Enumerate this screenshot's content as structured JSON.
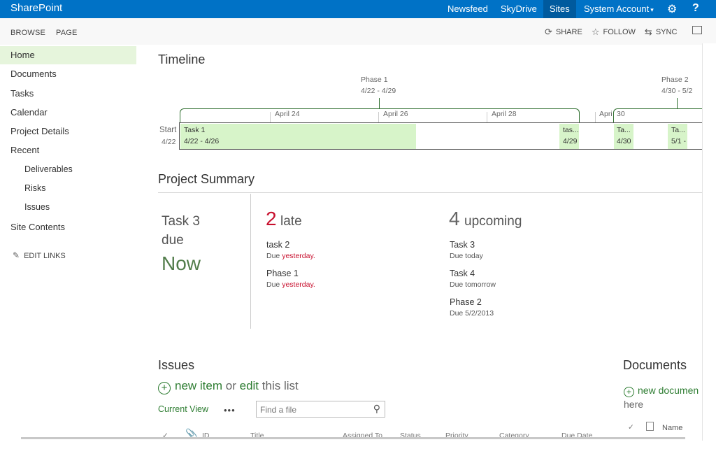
{
  "suite": {
    "brand": "SharePoint",
    "links": [
      "Newsfeed",
      "SkyDrive",
      "Sites"
    ],
    "account": "System Account",
    "caret": "▾",
    "help": "?"
  },
  "ribbon": {
    "tabs": [
      "BROWSE",
      "PAGE"
    ],
    "actions": [
      "SHARE",
      "FOLLOW",
      "SYNC"
    ]
  },
  "nav": {
    "items": [
      "Home",
      "Documents",
      "Tasks",
      "Calendar",
      "Project Details",
      "Recent"
    ],
    "recent": [
      "Deliverables",
      "Risks",
      "Issues"
    ],
    "site_contents": "Site Contents",
    "edit_links": "EDIT LINKS"
  },
  "timeline": {
    "title": "Timeline",
    "phase1": {
      "name": "Phase 1",
      "dates": "4/22 - 4/29"
    },
    "phase2": {
      "name": "Phase 2",
      "dates": "4/30 - 5/2"
    },
    "dates": [
      "April 24",
      "April 26",
      "April 28",
      "Apri",
      "30"
    ],
    "start_label": "Start",
    "start_date": "4/22",
    "tasks": [
      {
        "name": "Task 1",
        "dates": "4/22 - 4/26"
      },
      {
        "name": "tas...",
        "dates": "4/29"
      },
      {
        "name": "Ta...",
        "dates": "4/30"
      },
      {
        "name": "Ta...",
        "dates": "5/1 -"
      }
    ]
  },
  "summary": {
    "title": "Project Summary",
    "due_task": "Task 3",
    "due_word": "due",
    "due_when": "Now",
    "late": {
      "count": "2",
      "label": "late",
      "items": [
        {
          "name": "task 2",
          "due_prefix": "Due ",
          "due_value": "yesterday."
        },
        {
          "name": "Phase 1",
          "due_prefix": "Due ",
          "due_value": "yesterday."
        }
      ]
    },
    "upcoming": {
      "count": "4",
      "label": "upcoming",
      "items": [
        {
          "name": "Task 3",
          "due": "Due today"
        },
        {
          "name": "Task 4",
          "due": "Due tomorrow"
        },
        {
          "name": "Phase 2",
          "due": "Due 5/2/2013"
        }
      ]
    }
  },
  "issues": {
    "title": "Issues",
    "new_item": "new item",
    "or": "or",
    "edit": "edit",
    "this_list": "this list",
    "current_view": "Current View",
    "more": "•••",
    "search_placeholder": "Find a file",
    "columns": [
      "ID",
      "Title",
      "Assigned To",
      "Status",
      "Priority",
      "Category",
      "Due Date"
    ]
  },
  "documents": {
    "title": "Documents",
    "new_document": "new documen",
    "here": "here",
    "column": "Name"
  },
  "colors": {
    "suite_bar": "#0072c6",
    "accent_green": "#2e7d32",
    "task_fill": "#d7f4c9",
    "late_red": "#c8102e"
  }
}
